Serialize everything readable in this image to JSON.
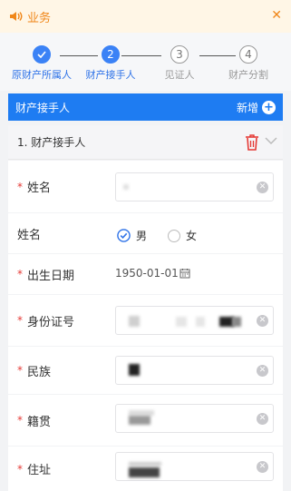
{
  "notice": {
    "text": "业务",
    "partial_char": " "
  },
  "steps": [
    {
      "number": "",
      "label": "原财产所属人",
      "state": "done"
    },
    {
      "number": "2",
      "label": "财产接手人",
      "state": "active"
    },
    {
      "number": "3",
      "label": "见证人",
      "state": "todo"
    },
    {
      "number": "4",
      "label": "财产分割",
      "state": "todo"
    }
  ],
  "section": {
    "title": "财产接手人",
    "add_label": "新增"
  },
  "card": {
    "title": "1. 财产接手人"
  },
  "form": {
    "name_label": "姓名",
    "gender_label": "姓名",
    "gender_male": "男",
    "gender_female": "女",
    "birth_label": "出生日期",
    "birth_value": "1950-01-01",
    "id_label": "身份证号",
    "ethnic_label": "民族",
    "origin_label": "籍贯",
    "address_label": "住址"
  }
}
